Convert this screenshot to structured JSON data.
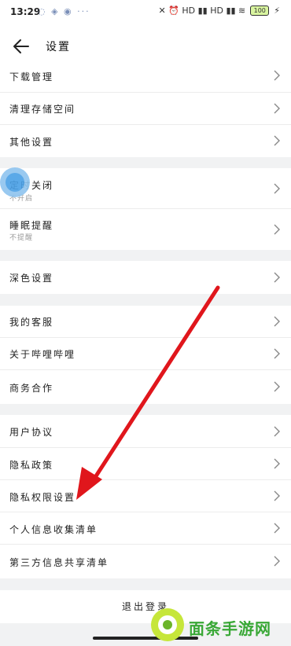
{
  "status_bar": {
    "time": "13:29",
    "left_icons": "◌ ◈ ◉ ···",
    "right_icons": "✕ ⏰ HD ▮▮ HD ▮▮ ≋",
    "battery": "100",
    "charging": "⚡"
  },
  "header": {
    "title": "设置"
  },
  "groups": [
    {
      "items": [
        {
          "label": "下载管理"
        },
        {
          "label": "清理存储空间"
        },
        {
          "label": "其他设置"
        }
      ]
    },
    {
      "items": [
        {
          "label": "定时关闭",
          "sub": "不开启"
        },
        {
          "label": "睡眠提醒",
          "sub": "不提醒"
        }
      ]
    },
    {
      "items": [
        {
          "label": "深色设置"
        }
      ]
    },
    {
      "items": [
        {
          "label": "我的客服"
        },
        {
          "label": "关于哔哩哔哩"
        },
        {
          "label": "商务合作"
        }
      ]
    },
    {
      "items": [
        {
          "label": "用户协议"
        },
        {
          "label": "隐私政策"
        },
        {
          "label": "隐私权限设置"
        },
        {
          "label": "个人信息收集清单"
        },
        {
          "label": "第三方信息共享清单"
        }
      ]
    }
  ],
  "logout": {
    "label": "退出登录"
  },
  "watermark": {
    "name": "面条手游网"
  },
  "colors": {
    "annotation_arrow": "#e0161c",
    "watermark_green": "#39a836"
  }
}
